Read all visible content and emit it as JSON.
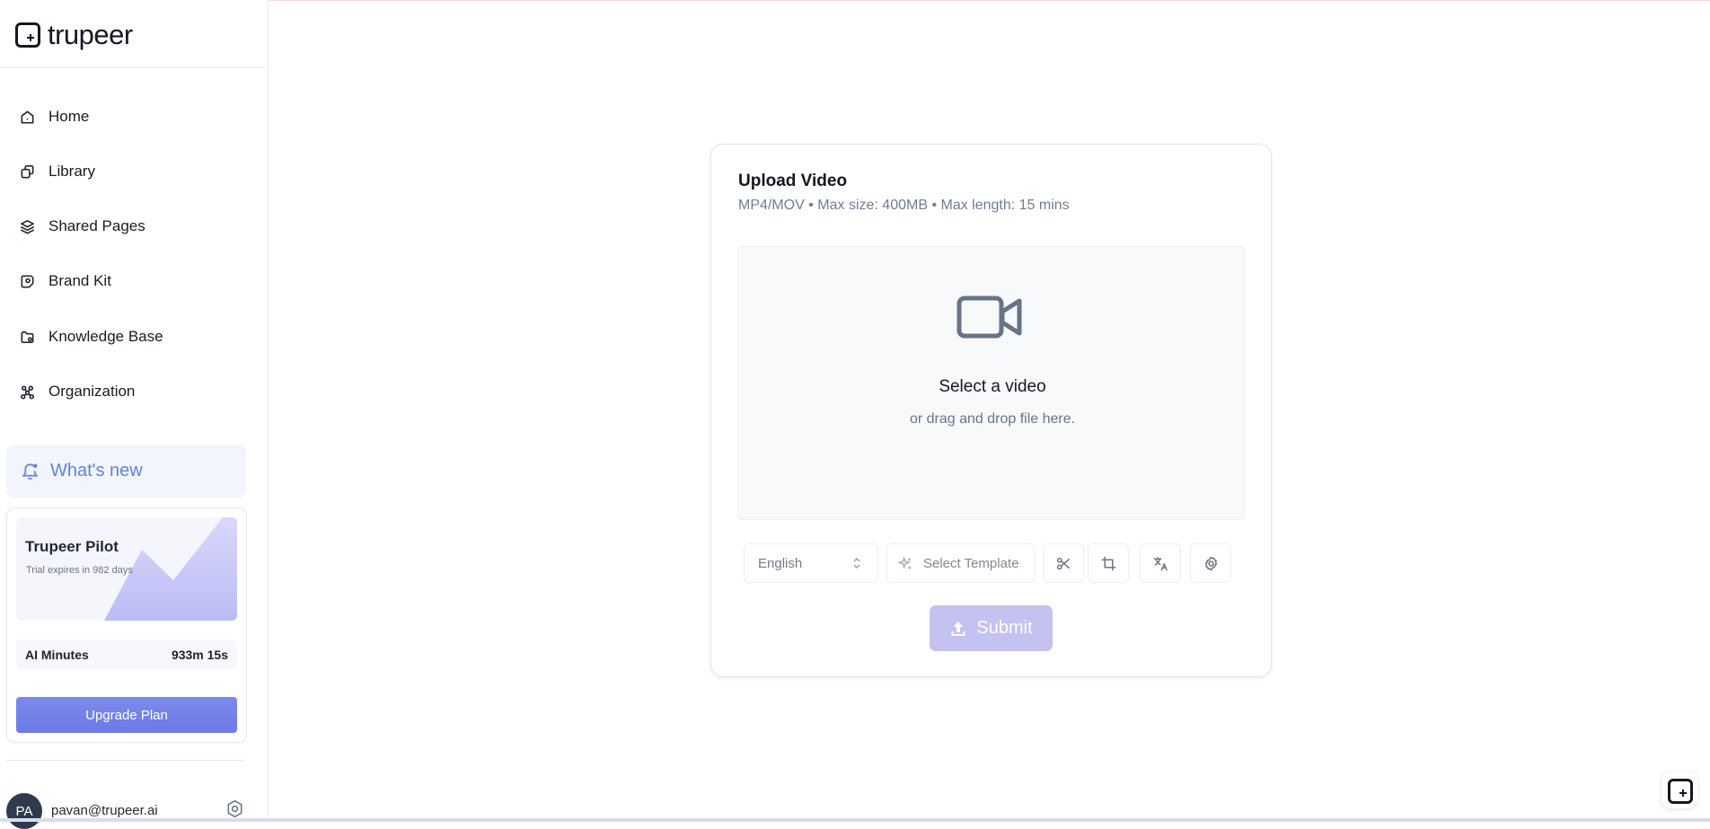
{
  "brand": {
    "name": "trupeer"
  },
  "sidebar": {
    "items": [
      {
        "label": "Home",
        "icon": "home-icon"
      },
      {
        "label": "Library",
        "icon": "library-icon"
      },
      {
        "label": "Shared Pages",
        "icon": "layers-icon"
      },
      {
        "label": "Brand Kit",
        "icon": "brand-kit-icon"
      },
      {
        "label": "Knowledge Base",
        "icon": "knowledge-base-icon"
      },
      {
        "label": "Organization",
        "icon": "organization-icon"
      }
    ],
    "whats_new": "What's new",
    "pilot": {
      "title": "Trupeer Pilot",
      "trial": "Trial expires in 982 days",
      "ai_minutes_label": "AI Minutes",
      "ai_minutes_value": "933m 15s",
      "upgrade_label": "Upgrade Plan"
    },
    "user": {
      "initials": "PA",
      "email": "pavan@trupeer.ai"
    }
  },
  "upload": {
    "title": "Upload Video",
    "subtitle": "MP4/MOV • Max size: 400MB • Max length: 15 mins",
    "dropzone_title": "Select a video",
    "dropzone_subtitle": "or drag and drop file here.",
    "language": "English",
    "template": "Select Template",
    "submit": "Submit"
  },
  "colors": {
    "accent": "#6d79e6",
    "whats_new_text": "#5e83df",
    "submit_disabled": "#c5c1f0"
  }
}
